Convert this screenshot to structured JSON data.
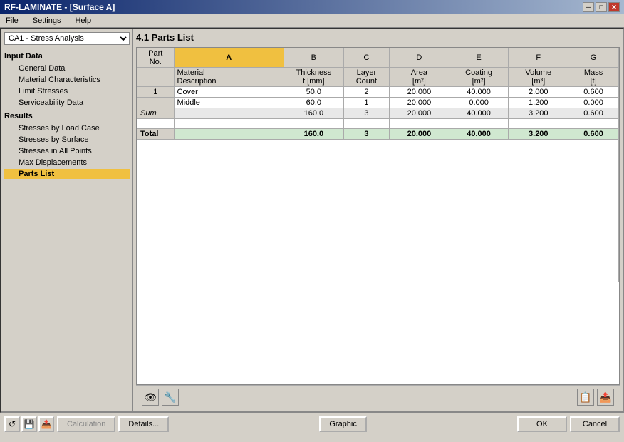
{
  "window": {
    "title": "RF-LAMINATE - [Surface A]",
    "close_btn": "✕",
    "minimize_btn": "─",
    "maximize_btn": "□"
  },
  "menu": {
    "items": [
      "File",
      "Settings",
      "Help"
    ]
  },
  "left_panel": {
    "dropdown": {
      "value": "CA1 - Stress Analysis",
      "options": [
        "CA1 - Stress Analysis"
      ]
    },
    "input_data_label": "Input Data",
    "nav_items_input": [
      {
        "id": "general-data",
        "label": "General Data",
        "active": false
      },
      {
        "id": "material-characteristics",
        "label": "Material Characteristics",
        "active": false
      },
      {
        "id": "limit-stresses",
        "label": "Limit Stresses",
        "active": false
      },
      {
        "id": "serviceability-data",
        "label": "Serviceability Data",
        "active": false
      }
    ],
    "results_label": "Results",
    "nav_items_results": [
      {
        "id": "stresses-by-load-case",
        "label": "Stresses by Load Case",
        "active": false
      },
      {
        "id": "stresses-by-surface",
        "label": "Stresses by Surface",
        "active": false
      },
      {
        "id": "stresses-in-all-points",
        "label": "Stresses in All Points",
        "active": false
      },
      {
        "id": "max-displacements",
        "label": "Max Displacements",
        "active": false
      },
      {
        "id": "parts-list",
        "label": "Parts List",
        "active": true
      }
    ]
  },
  "right_panel": {
    "section_title": "4.1 Parts List",
    "table": {
      "columns": [
        {
          "id": "part_no",
          "label": "Part\nNo."
        },
        {
          "id": "a",
          "label": "A"
        },
        {
          "id": "b",
          "label": "B"
        },
        {
          "id": "c",
          "label": "C"
        },
        {
          "id": "d",
          "label": "D"
        },
        {
          "id": "e",
          "label": "E"
        },
        {
          "id": "f",
          "label": "F"
        },
        {
          "id": "g",
          "label": "G"
        }
      ],
      "col_headers_2": [
        "",
        "Material\nDescription",
        "Thickness\nt [mm]",
        "Layer\nCount",
        "Area\n[m²]",
        "Coating\n[m²]",
        "Volume\n[m³]",
        "Mass\n[t]"
      ],
      "rows": [
        {
          "type": "data",
          "part_no": "1",
          "desc": "Cover",
          "thickness": "50.0",
          "layer_count": "2",
          "area": "20.000",
          "coating": "40.000",
          "volume": "2.000",
          "mass": "0.600"
        },
        {
          "type": "data",
          "part_no": "",
          "desc": "Middle",
          "thickness": "60.0",
          "layer_count": "1",
          "area": "20.000",
          "coating": "0.000",
          "volume": "1.200",
          "mass": "0.000"
        },
        {
          "type": "sum",
          "part_no": "Sum",
          "desc": "",
          "thickness": "160.0",
          "layer_count": "3",
          "area": "20.000",
          "coating": "40.000",
          "volume": "3.200",
          "mass": "0.600"
        },
        {
          "type": "empty"
        },
        {
          "type": "total",
          "part_no": "Total",
          "desc": "",
          "thickness": "160.0",
          "layer_count": "3",
          "area": "20.000",
          "coating": "40.000",
          "volume": "3.200",
          "mass": "0.600"
        }
      ]
    }
  },
  "toolbar_bottom": {
    "left_icons": [
      "👁",
      "🔧"
    ],
    "right_icons": [
      "📋",
      "📤"
    ]
  },
  "bottom_bar": {
    "icon_btns": [
      "↺",
      "💾",
      "📤"
    ],
    "calculation_btn": "Calculation",
    "details_btn": "Details...",
    "graphic_btn": "Graphic",
    "ok_btn": "OK",
    "cancel_btn": "Cancel"
  }
}
